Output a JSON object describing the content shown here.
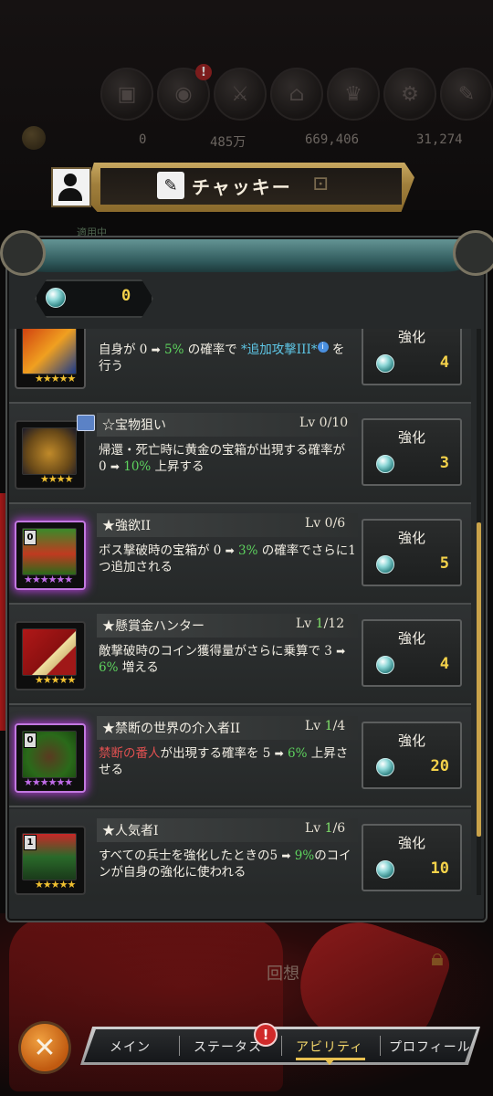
{
  "header": {
    "character_name": "チャッキー",
    "gem_count": "0"
  },
  "background": {
    "currencies": [
      "0",
      "485万",
      "669,406",
      "31,274"
    ],
    "recall_label": "回想",
    "equipped_label": "適用中"
  },
  "abilities": [
    {
      "title": "",
      "level_prefix": "",
      "level_current": "",
      "level_max": "",
      "desc_parts": [
        "自身が 0 ",
        "➡",
        " ",
        "5%",
        " の確率で ",
        "*追加攻撃III*",
        "",
        " を行う"
      ],
      "button_label": "強化",
      "cost": "4",
      "rarity": "gold",
      "stars": "★★★★★"
    },
    {
      "title": "☆宝物狙い",
      "level_prefix": "Lv ",
      "level_current": "0",
      "level_max": "/10",
      "desc_parts": [
        "帰還・死亡時に黄金の宝箱が出現する確率が 0 ",
        "➡",
        " ",
        "10%",
        " 上昇する"
      ],
      "button_label": "強化",
      "cost": "3",
      "rarity": "gold",
      "stars": "★★★★"
    },
    {
      "title": "★強欲II",
      "level_prefix": "Lv ",
      "level_current": "0",
      "level_max": "/6",
      "desc_parts": [
        "ボス撃破時の宝箱が 0 ",
        "➡",
        " ",
        "3%",
        " の確率でさらに1つ追加される"
      ],
      "button_label": "強化",
      "cost": "5",
      "rarity": "purple",
      "stars": "★★★★★★"
    },
    {
      "title": "★懸賞金ハンター",
      "level_prefix": "Lv ",
      "level_current": "1",
      "level_max": "/12",
      "desc_parts": [
        "敵撃破時のコイン獲得量がさらに乗算で 3 ",
        "➡",
        " ",
        "6%",
        "  増える"
      ],
      "button_label": "強化",
      "cost": "4",
      "rarity": "gold",
      "stars": "★★★★★"
    },
    {
      "title": "★禁断の世界の介入者II",
      "level_prefix": "Lv ",
      "level_current": "1",
      "level_max": "/4",
      "desc_parts": [
        "禁断の番人",
        "が出現する確率を 5 ",
        "➡",
        " ",
        "6%",
        " 上昇させる"
      ],
      "button_label": "強化",
      "cost": "20",
      "rarity": "purple",
      "stars": "★★★★★★"
    },
    {
      "title": "★人気者I",
      "level_prefix": "Lv ",
      "level_current": "1",
      "level_max": "/6",
      "desc_parts": [
        "すべての兵士を強化したときの5 ",
        "➡",
        " ",
        "9%",
        "のコインが自身の強化に使われる"
      ],
      "button_label": "強化",
      "cost": "10",
      "rarity": "gold",
      "stars": "★★★★★"
    }
  ],
  "nav": {
    "tabs": [
      "メイン",
      "ステータス",
      "アビリティ",
      "プロフィール"
    ],
    "active_tab": "アビリティ",
    "alert_mark": "!",
    "close_mark": "✕"
  },
  "colors": {
    "highlight_green": "#5ed45e",
    "highlight_red": "#e05050",
    "cost_yellow": "#f4d24a",
    "active_tab": "#f2d56a"
  }
}
